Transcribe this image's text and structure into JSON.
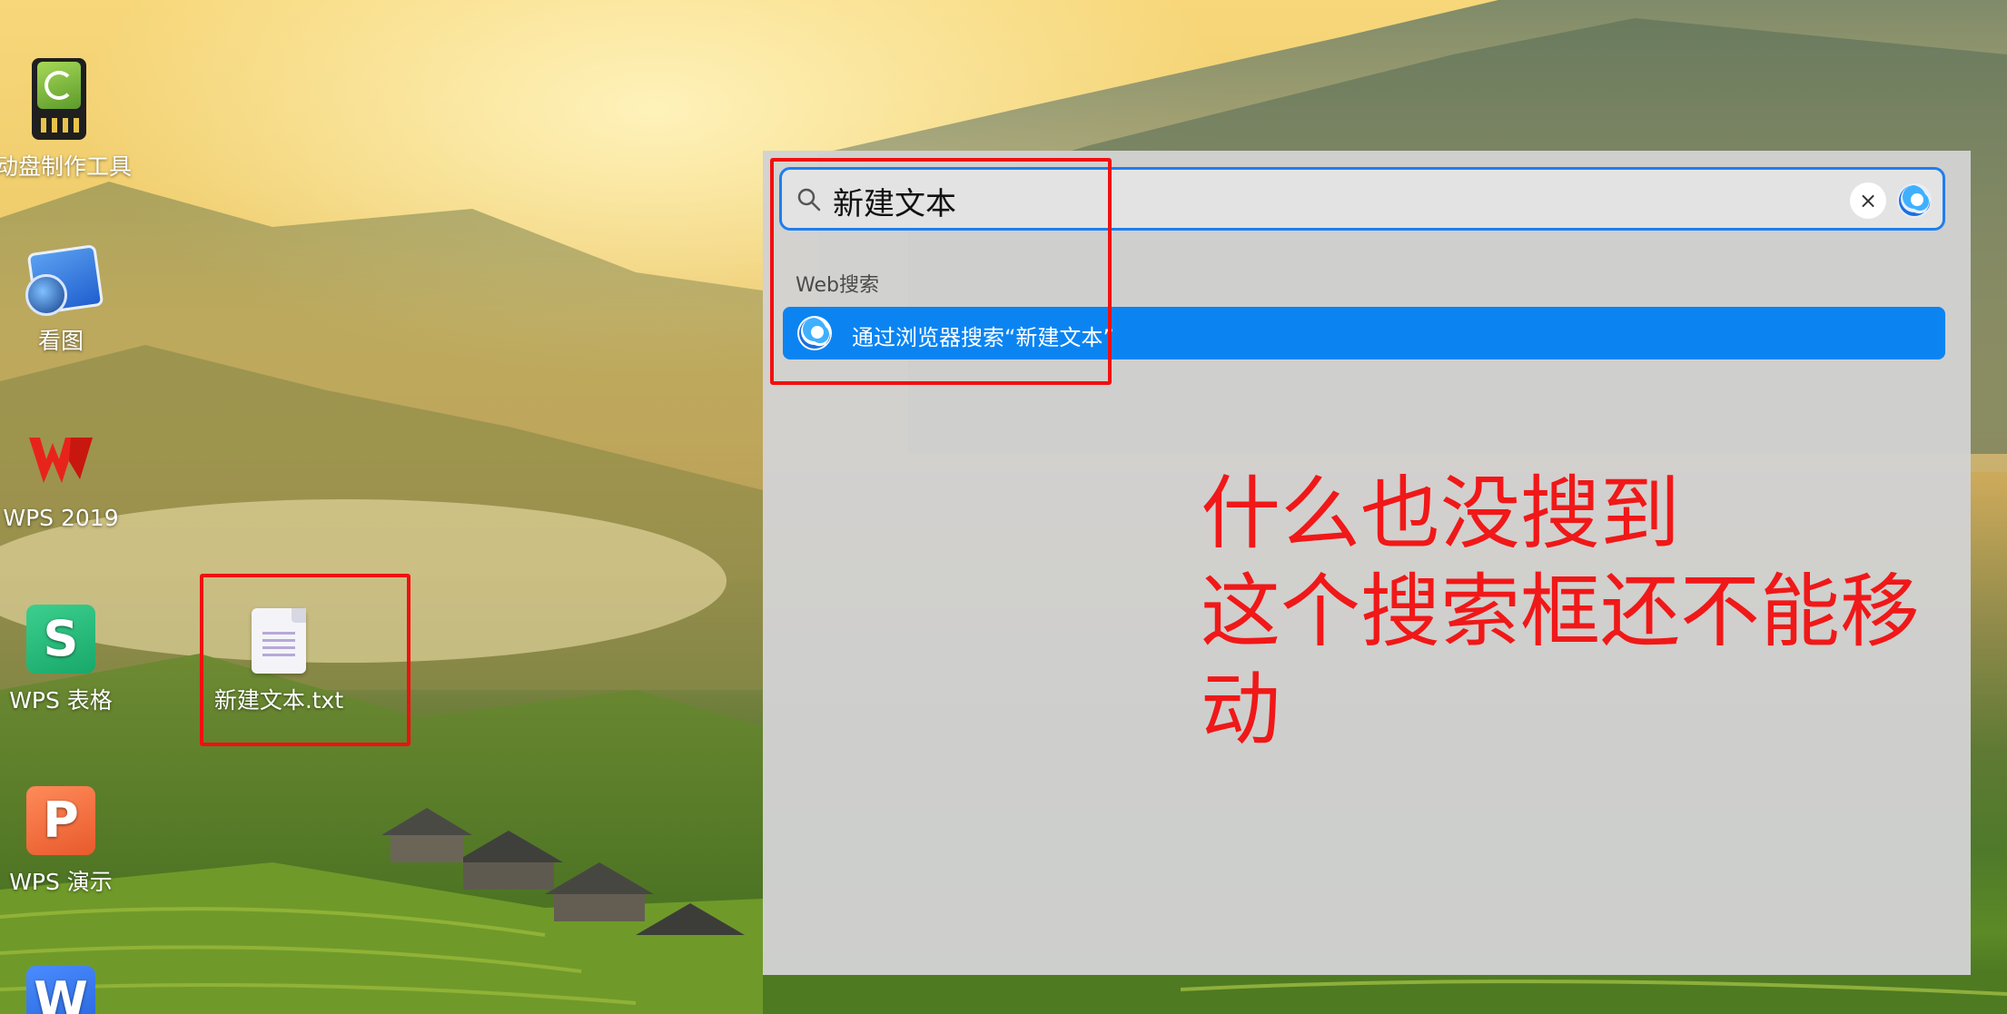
{
  "desktop": {
    "icons": [
      {
        "name": "usb-boot-maker",
        "label": "启动盘制作工具"
      },
      {
        "name": "image-viewer",
        "label": "看图"
      },
      {
        "name": "wps-2019",
        "label": "WPS 2019"
      },
      {
        "name": "wps-spreadsheet",
        "label": "WPS 表格",
        "glyph": "S"
      },
      {
        "name": "new-text-file",
        "label": "新建文本.txt"
      },
      {
        "name": "wps-presentation",
        "label": "WPS 演示",
        "glyph": "P"
      },
      {
        "name": "wps-writer",
        "glyph": "W"
      }
    ]
  },
  "launcher": {
    "search": {
      "value": "新建文本",
      "clear_label": "×"
    },
    "section_label": "Web搜索",
    "result_label": "通过浏览器搜索“新建文本”"
  },
  "annotation": {
    "lines": [
      "什么也没搜到",
      "这个搜索框还不能移",
      "动"
    ]
  },
  "colors": {
    "accent": "#0b84f2",
    "search_border": "#1e7ef0",
    "annotation_red": "#f01010",
    "panel_bg": "#d2d2d2"
  }
}
